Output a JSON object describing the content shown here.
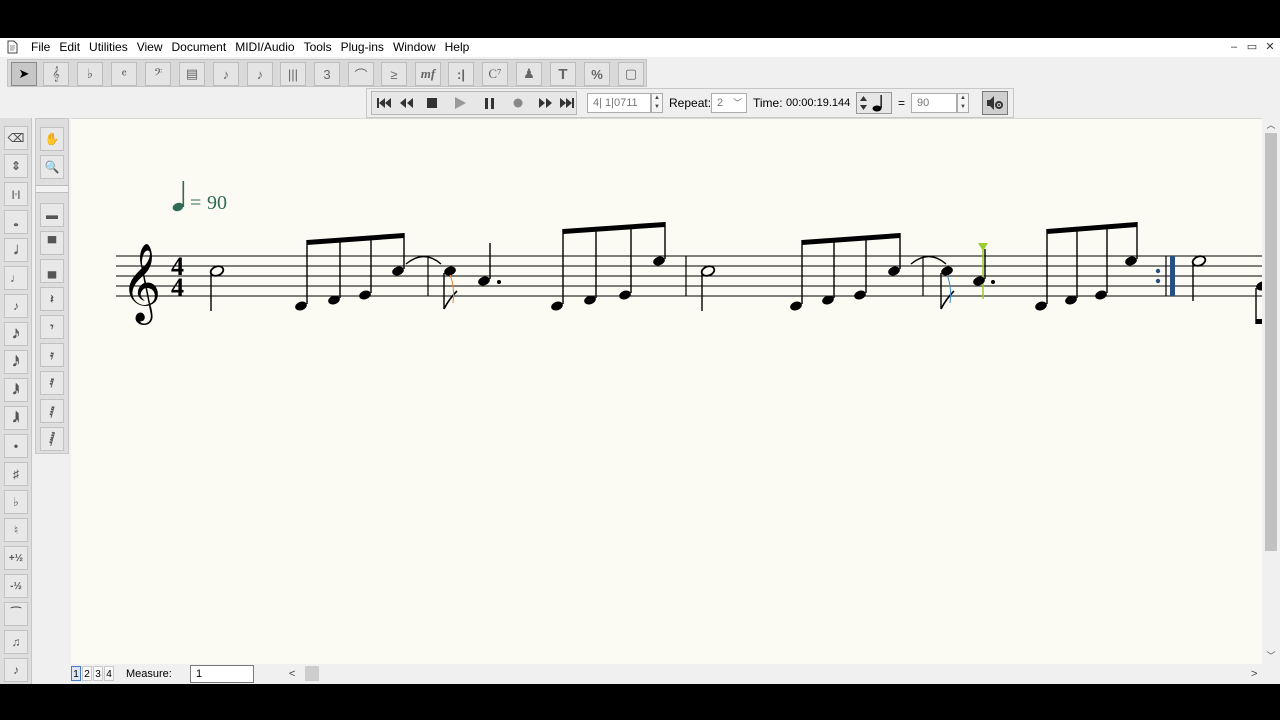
{
  "menu": {
    "items": [
      "File",
      "Edit",
      "Utilities",
      "View",
      "Document",
      "MIDI/Audio",
      "Tools",
      "Plug-ins",
      "Window",
      "Help"
    ]
  },
  "window_controls": {
    "minimize": "–",
    "restore": "▭",
    "close": "✕"
  },
  "palette": {
    "tools": [
      {
        "name": "selection-tool-icon",
        "glyph": "➤"
      },
      {
        "name": "staff-tool-icon",
        "glyph": "𝄞"
      },
      {
        "name": "key-signature-tool-icon",
        "glyph": "♭"
      },
      {
        "name": "time-signature-tool-icon",
        "glyph": "𝄴"
      },
      {
        "name": "clef-tool-icon",
        "glyph": "𝄢"
      },
      {
        "name": "measure-tool-icon",
        "glyph": "▤"
      },
      {
        "name": "simple-entry-tool-icon",
        "glyph": "♪"
      },
      {
        "name": "speedy-entry-tool-icon",
        "glyph": "♪"
      },
      {
        "name": "hyperscribe-tool-icon",
        "glyph": "|||"
      },
      {
        "name": "tuplet-tool-icon",
        "glyph": "3"
      },
      {
        "name": "smart-shape-tool-icon",
        "glyph": "⌒"
      },
      {
        "name": "articulation-tool-icon",
        "glyph": "≥"
      },
      {
        "name": "expression-tool-icon",
        "glyph": "mf"
      },
      {
        "name": "repeat-tool-icon",
        "glyph": ":|"
      },
      {
        "name": "chord-tool-icon",
        "glyph": "C⁷"
      },
      {
        "name": "lyrics-tool-icon",
        "glyph": "♟"
      },
      {
        "name": "text-tool-icon",
        "glyph": "T"
      },
      {
        "name": "percent-tool-icon",
        "glyph": "%"
      },
      {
        "name": "graphics-tool-icon",
        "glyph": "▢"
      }
    ]
  },
  "playback": {
    "counter": "4| 1|0711",
    "repeat_label": "Repeat:",
    "repeat_value": "2",
    "time_label": "Time:",
    "time_value": "00:00:19.144",
    "equals": "=",
    "tempo_value": "90"
  },
  "score": {
    "tempo_number": "90",
    "time_signature_top": "4",
    "time_signature_bottom": "4"
  },
  "bottom": {
    "pages": [
      "1",
      "2",
      "3",
      "4"
    ],
    "measure_label": "Measure:",
    "measure_value": "1",
    "scroll_left": "<",
    "scroll_right": ">"
  },
  "left_tools_col1": [
    "eraser",
    "swap",
    "measure-stretch",
    "whole",
    "half",
    "quarter",
    "eighth",
    "sixteenth",
    "thirtysecond",
    "sixtyfourth",
    "onetwentyeighth",
    "dot",
    "sharp",
    "flat",
    "natural",
    "+½",
    "-½",
    "tie",
    "beam",
    "grace"
  ],
  "left_tools_col2": [
    "hand",
    "zoom",
    "rest-whole",
    "rest-half",
    "rest-bar",
    "rest-quarter",
    "rest-eighth",
    "rest-16",
    "rest-32",
    "rest-64",
    "rest-128"
  ],
  "colors": {
    "background": "#f0f0f0",
    "score_paper": "#fbfbf4",
    "tempo_mark": "#2f6b55",
    "repeat_bar_accent": "#2a4f85",
    "playback_cursor": "#9acd32"
  }
}
